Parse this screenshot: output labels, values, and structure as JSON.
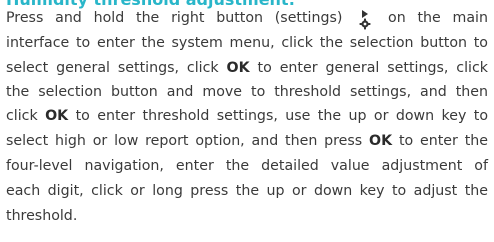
{
  "heading": "Humidity threshold adjustment:",
  "icons": {
    "settings_button": "play-triangle-over-gear-icon"
  },
  "paragraph": {
    "line1": {
      "before_icon": "Press and hold the right button (settings)",
      "after_icon": "on the main"
    },
    "line2": "interface to enter the system menu, click the selection button to",
    "line3": {
      "a": "select general settings, click",
      "ok": "OK",
      "b": "to enter general settings, click"
    },
    "line4": "the selection button and move to threshold settings, and then",
    "line5": {
      "a": "click",
      "ok": "OK",
      "b": "to enter threshold settings, use the up or down key to"
    },
    "line6": {
      "a": "select high or low report option, and then press",
      "ok": "OK",
      "b": "to enter the"
    },
    "line7": "four-level navigation, enter the detailed value adjustment of",
    "line8": "each digit, click or long press the up or down key to adjust the",
    "line9": "threshold."
  }
}
